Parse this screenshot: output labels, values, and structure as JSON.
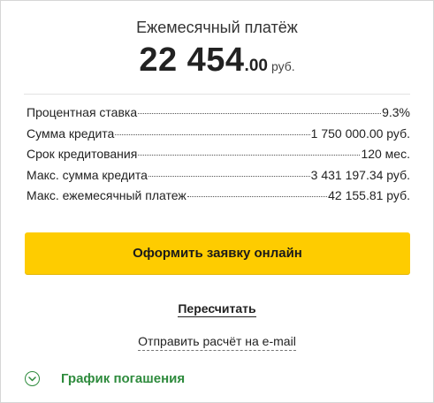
{
  "header": {
    "label": "Ежемесячный платёж",
    "amount_integer": "22 454",
    "amount_decimal": ".00",
    "currency": "руб."
  },
  "details": [
    {
      "name": "Процентная ставка",
      "value": "9.3%"
    },
    {
      "name": "Сумма кредита",
      "value": "1 750 000.00 руб."
    },
    {
      "name": "Срок кредитования",
      "value": "120 мес."
    },
    {
      "name": "Макс. сумма кредита",
      "value": "3 431 197.34 руб."
    },
    {
      "name": "Макс. ежемесячный платеж",
      "value": "42 155.81 руб."
    }
  ],
  "actions": {
    "apply_label": "Оформить заявку онлайн",
    "recalc_label": "Пересчитать",
    "email_label": "Отправить расчёт на e-mail",
    "schedule_label": "График погашения",
    "schedule_icon": "chevron-down-circle-icon"
  },
  "colors": {
    "accent_button": "#fecc00",
    "link_green": "#2e8b3d"
  }
}
